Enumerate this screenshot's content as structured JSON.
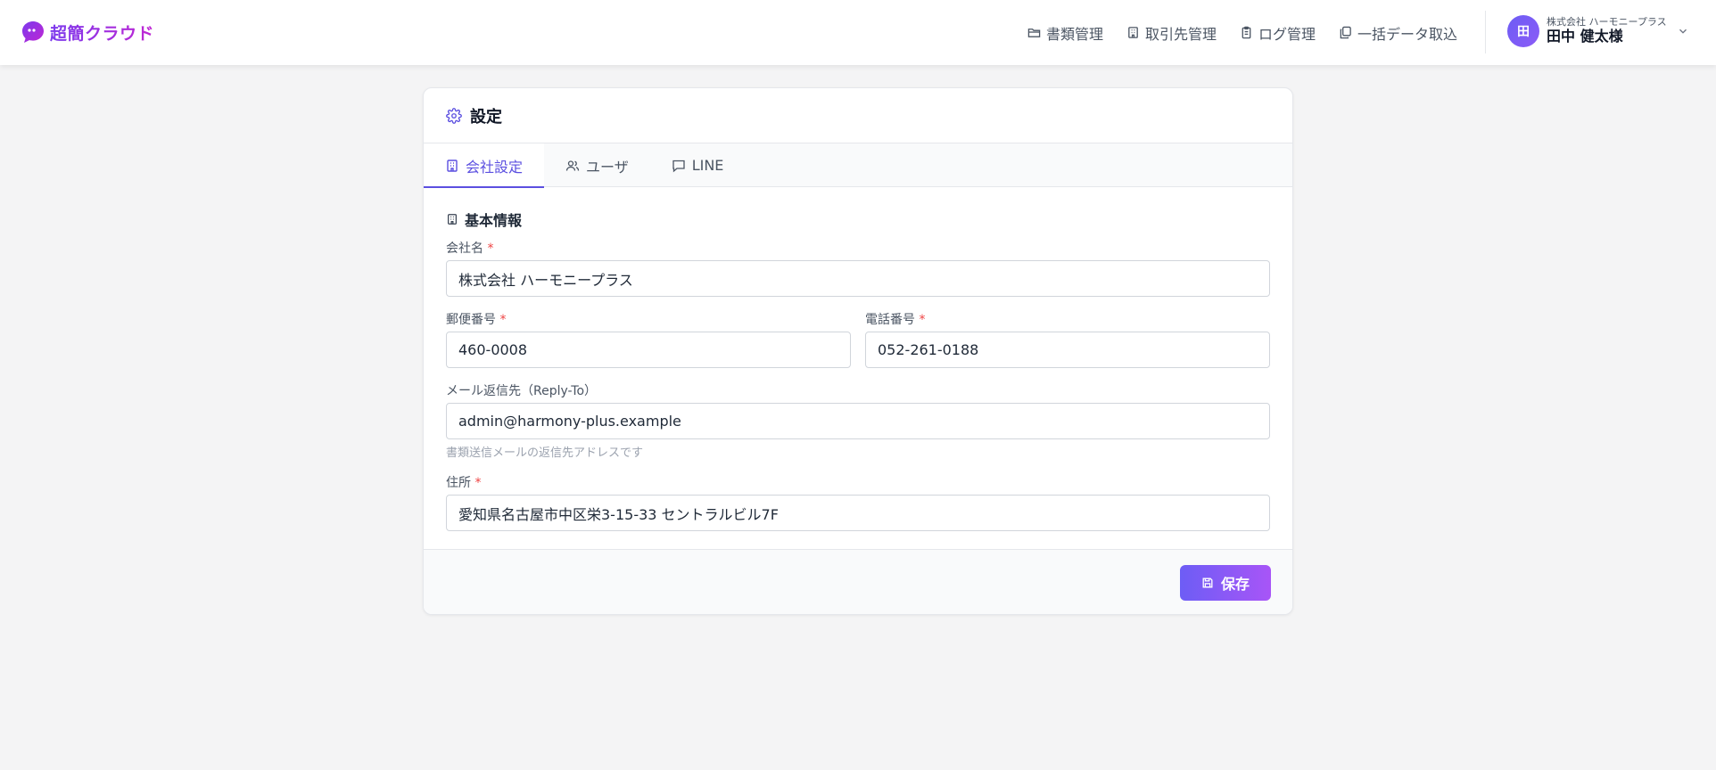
{
  "app": {
    "brand": "超簡クラウド",
    "accent": "#5b4fe0",
    "gradient": [
      "#6d5df5",
      "#a855f7"
    ]
  },
  "nav": [
    {
      "label": "書類管理",
      "icon": "folder-icon"
    },
    {
      "label": "取引先管理",
      "icon": "building-icon"
    },
    {
      "label": "ログ管理",
      "icon": "clipboard-icon"
    },
    {
      "label": "一括データ取込",
      "icon": "copy-icon"
    }
  ],
  "user": {
    "avatar": "田",
    "company": "株式会社 ハーモニープラス",
    "name": "田中 健太様"
  },
  "settings": {
    "title": "設定",
    "tabs": [
      {
        "label": "会社設定",
        "active": true
      },
      {
        "label": "ユーザ",
        "active": false
      },
      {
        "label": "LINE",
        "active": false
      }
    ],
    "section_title": "基本情報",
    "fields": {
      "company_name": {
        "label": "会社名",
        "required": "*",
        "value": "株式会社 ハーモニープラス"
      },
      "postal_code": {
        "label": "郵便番号",
        "required": "*",
        "value": "460-0008"
      },
      "phone": {
        "label": "電話番号",
        "required": "*",
        "value": "052-261-0188"
      },
      "reply_to": {
        "label": "メール返信先（Reply-To）",
        "value": "admin@harmony-plus.example",
        "hint": "書類送信メールの返信先アドレスです"
      },
      "address": {
        "label": "住所",
        "required": "*",
        "value": "愛知県名古屋市中区栄3-15-33 セントラルビル7F"
      }
    },
    "save_label": "保存"
  }
}
